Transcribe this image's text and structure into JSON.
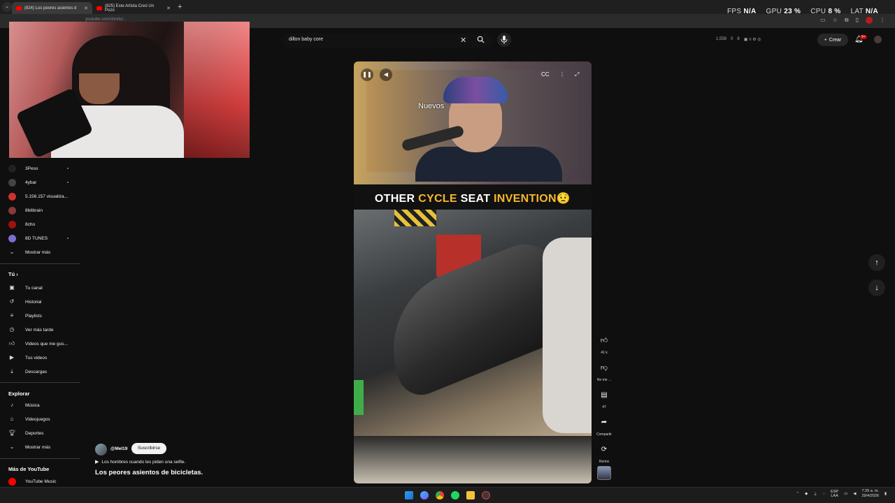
{
  "browser": {
    "tabs": [
      {
        "label": "(824) Los peores asientos d",
        "active": true
      },
      {
        "label": "(825) Este Artista Creó Un Pozo",
        "active": false
      }
    ],
    "url": "youtube.com/shorts/..."
  },
  "overlay_stats": {
    "fps_label": "FPS",
    "fps_value": "N/A",
    "gpu_label": "GPU",
    "gpu_value": "23 %",
    "cpu_label": "CPU",
    "cpu_value": "8 %",
    "lat_label": "LAT",
    "lat_value": "N/A"
  },
  "header": {
    "search_value": "dillon baby core",
    "counters": [
      "1,558",
      "0",
      "8"
    ],
    "create_label": "Crear",
    "notifications_badge": "9+"
  },
  "sidebar": {
    "subscriptions": [
      {
        "label": "3Peso",
        "color": "#222222",
        "new": true
      },
      {
        "label": "4ybar",
        "color": "#444444",
        "new": true
      },
      {
        "label": "5.156.157 visualiza...",
        "color": "#d32f2f",
        "new": false
      },
      {
        "label": "8bitbrain",
        "color": "#8a3a3a",
        "new": false
      },
      {
        "label": "8cho",
        "color": "#a01010",
        "new": false
      },
      {
        "label": "8D TUNES",
        "color": "#7b6fd0",
        "new": true
      }
    ],
    "show_more_1": "Mostrar más",
    "you_header": "Tú",
    "you_items": [
      {
        "label": "Tu canal",
        "icon": "user-box-icon"
      },
      {
        "label": "Historial",
        "icon": "history-icon"
      },
      {
        "label": "Playlists",
        "icon": "playlist-icon"
      },
      {
        "label": "Ver más tarde",
        "icon": "clock-icon"
      },
      {
        "label": "Videos que me gus...",
        "icon": "thumbs-up-icon"
      },
      {
        "label": "Tus videos",
        "icon": "video-icon"
      },
      {
        "label": "Descargas",
        "icon": "download-icon"
      }
    ],
    "explore_header": "Explorar",
    "explore_items": [
      {
        "label": "Música",
        "icon": "music-icon"
      },
      {
        "label": "Videojuegos",
        "icon": "gamepad-icon"
      },
      {
        "label": "Deportes",
        "icon": "trophy-icon"
      }
    ],
    "show_more_2": "Mostrar más",
    "more_header": "Más de YouTube",
    "more_items": [
      {
        "label": "YouTube Music",
        "icon": "youtube-music-icon"
      }
    ]
  },
  "short": {
    "overlay_text": "Nuevos",
    "title_parts": [
      "OTHER ",
      "CYCLE",
      " SEAT ",
      "INVENTION",
      "😟"
    ],
    "channel_handle": "@Mel19",
    "subscribe_label": "Suscribirse",
    "description": "Los hombres cuando les piden una selfie.",
    "main_title": "Los peores asientos de bicicletas."
  },
  "actions": {
    "like_count": "41 k",
    "dislike_label": "No me ...",
    "comments_count": "47",
    "share_label": "Compartir",
    "remix_label": "Remix"
  },
  "taskbar": {
    "lang_top": "ESP",
    "lang_bottom": "LAA",
    "time": "7:25 a. m.",
    "date": "29/4/2026"
  },
  "colors": {
    "background": "#0f0f0f",
    "subscribe_bg": "#f1f1f1",
    "title_yellow": "#f5b82e",
    "badge_red": "#cc0000"
  }
}
